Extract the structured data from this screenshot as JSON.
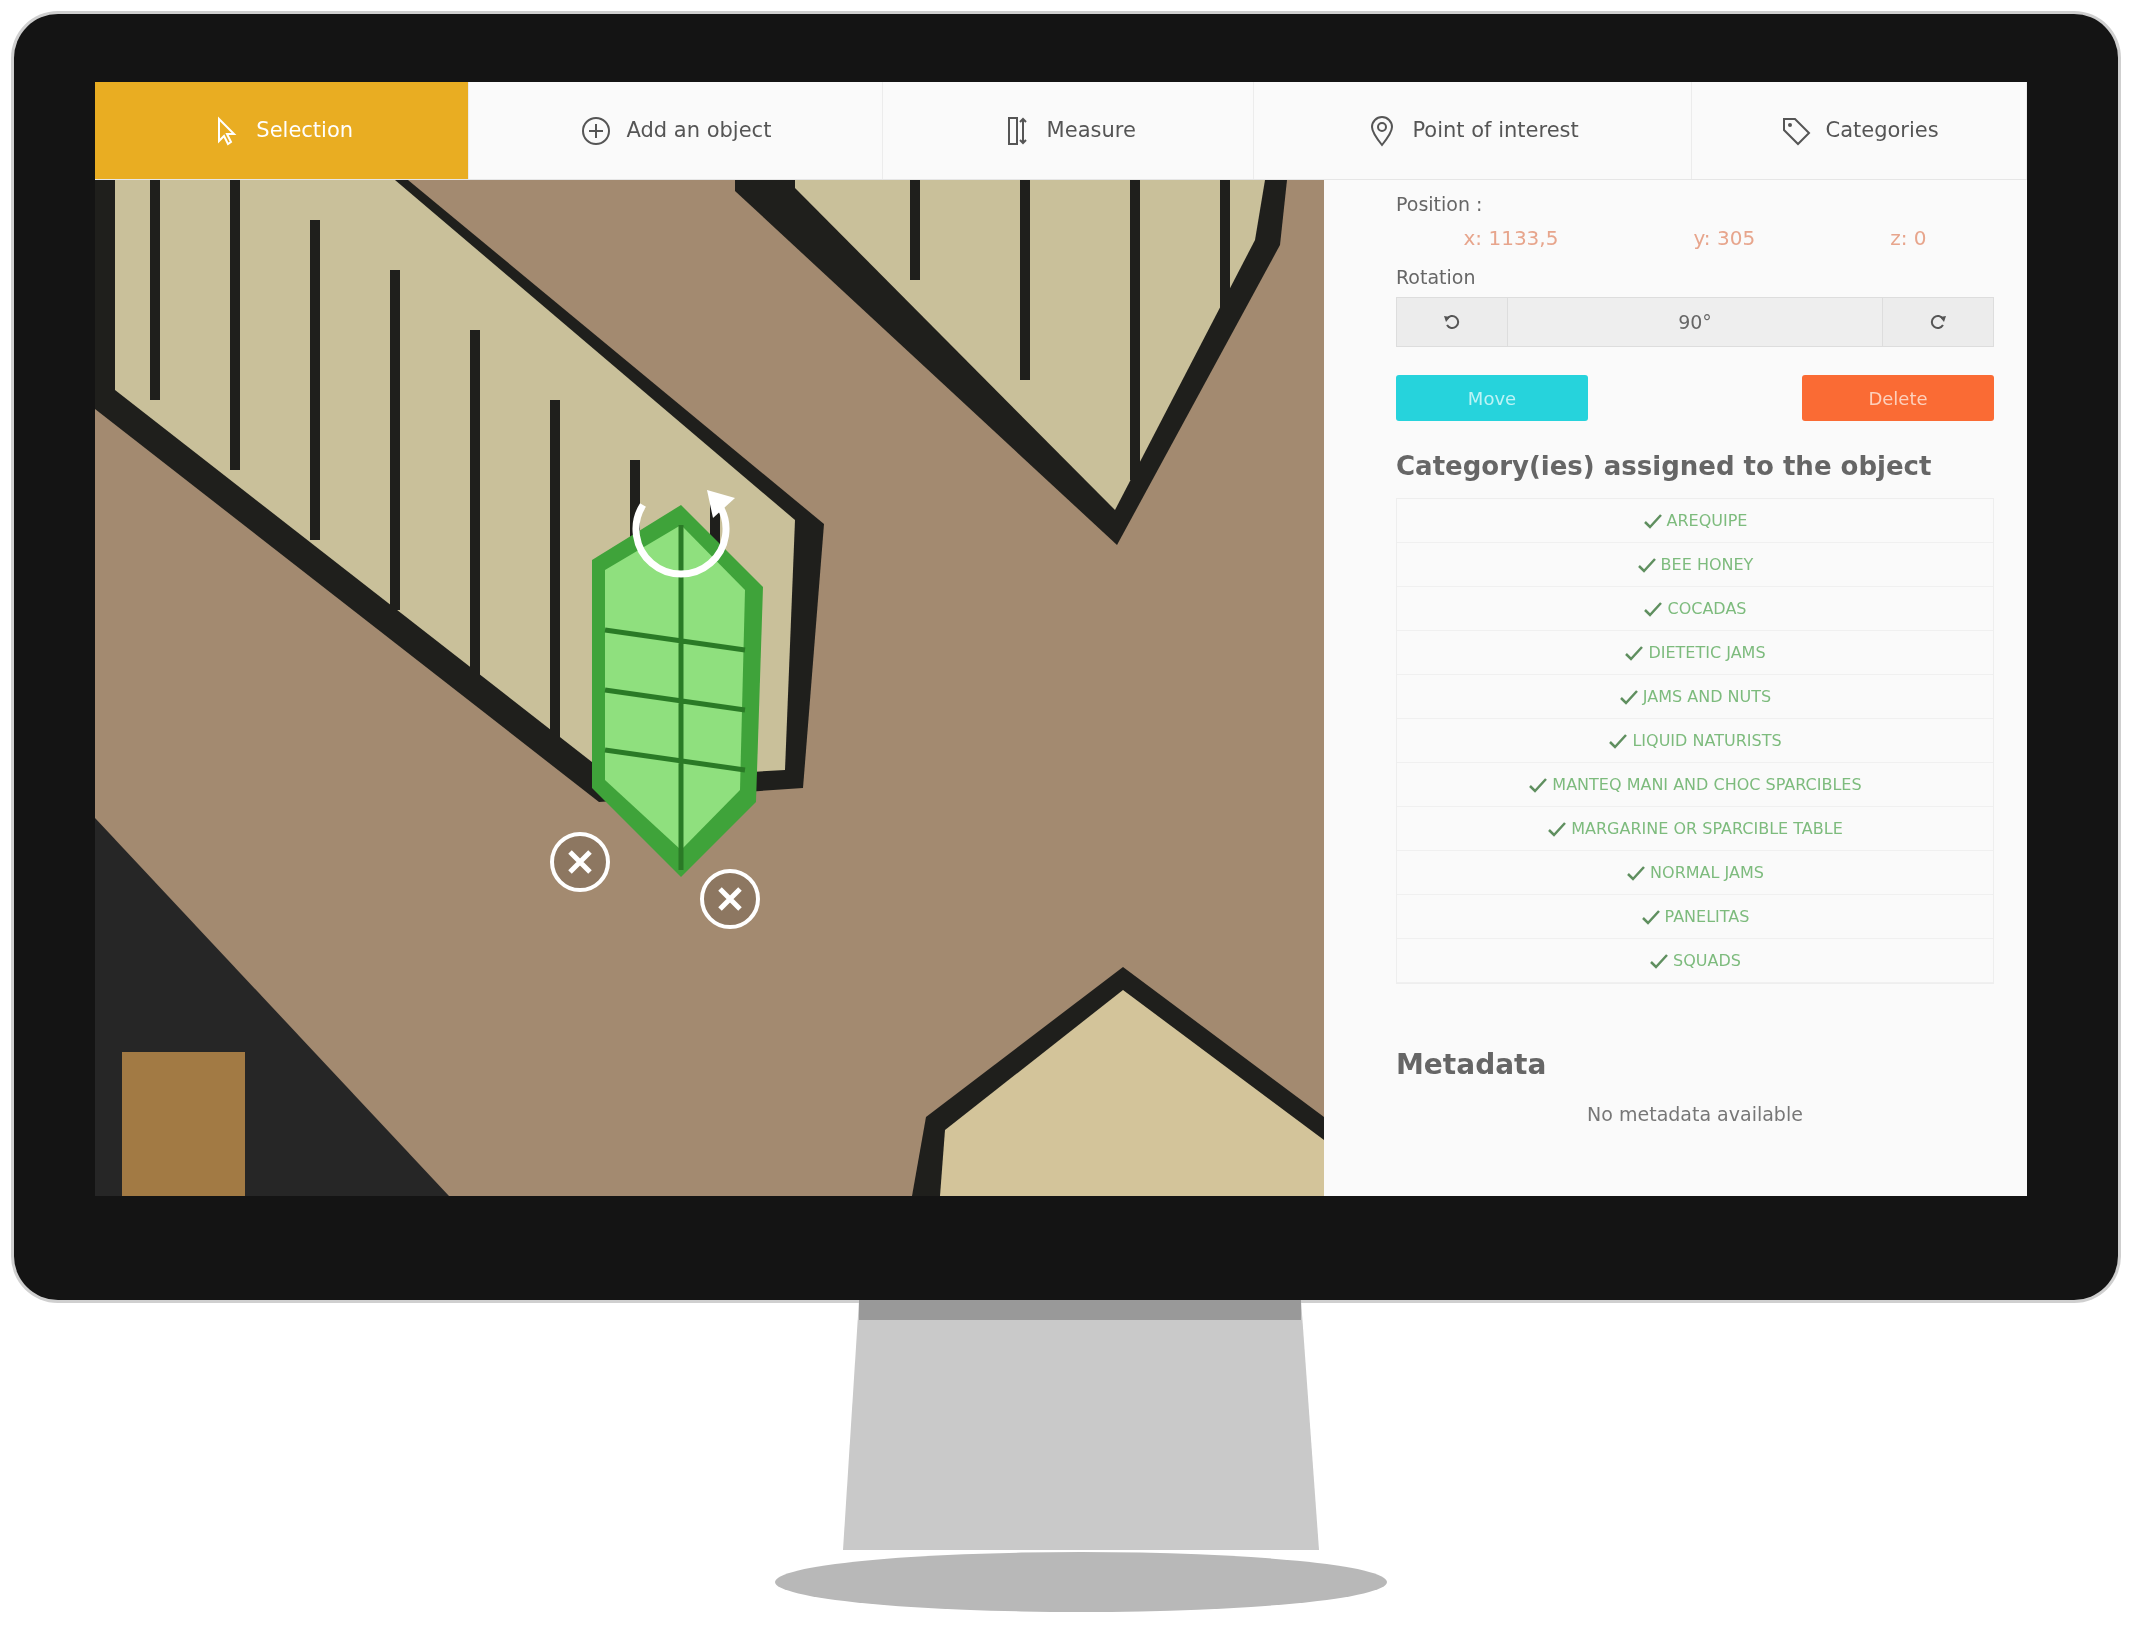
{
  "tabs": [
    {
      "label": "Selection",
      "kind": "cursor",
      "selected": true
    },
    {
      "label": "Add an object",
      "kind": "plus",
      "selected": false
    },
    {
      "label": "Measure",
      "kind": "ruler",
      "selected": false
    },
    {
      "label": "Point of interest",
      "kind": "pin",
      "selected": false
    },
    {
      "label": "Categories",
      "kind": "tag",
      "selected": false
    }
  ],
  "position": {
    "label": "Position :",
    "x": "x: 1133,5",
    "y": "y: 305",
    "z": "z: 0"
  },
  "rotation": {
    "label": "Rotation",
    "value": "90°"
  },
  "buttons": [
    {
      "label": "Move",
      "kind": "move"
    },
    {
      "label": "Delete",
      "kind": "delete"
    }
  ],
  "categories": {
    "title": "Category(ies) assigned to the object",
    "items": [
      {
        "label": "AREQUIPE",
        "checked": true
      },
      {
        "label": "BEE HONEY",
        "checked": true
      },
      {
        "label": "COCADAS",
        "checked": true
      },
      {
        "label": "DIETETIC JAMS",
        "checked": true
      },
      {
        "label": "JAMS AND NUTS",
        "checked": true
      },
      {
        "label": "LIQUID NATURISTS",
        "checked": true
      },
      {
        "label": "MANTEQ MANI AND CHOC SPARCIBLES",
        "checked": true
      },
      {
        "label": "MARGARINE OR SPARCIBLE TABLE",
        "checked": true
      },
      {
        "label": "NORMAL JAMS",
        "checked": true
      },
      {
        "label": "PANELITAS",
        "checked": true
      },
      {
        "label": "SQUADS",
        "checked": true
      }
    ]
  },
  "metadata": {
    "title": "Metadata",
    "empty_text": "No metadata available"
  }
}
